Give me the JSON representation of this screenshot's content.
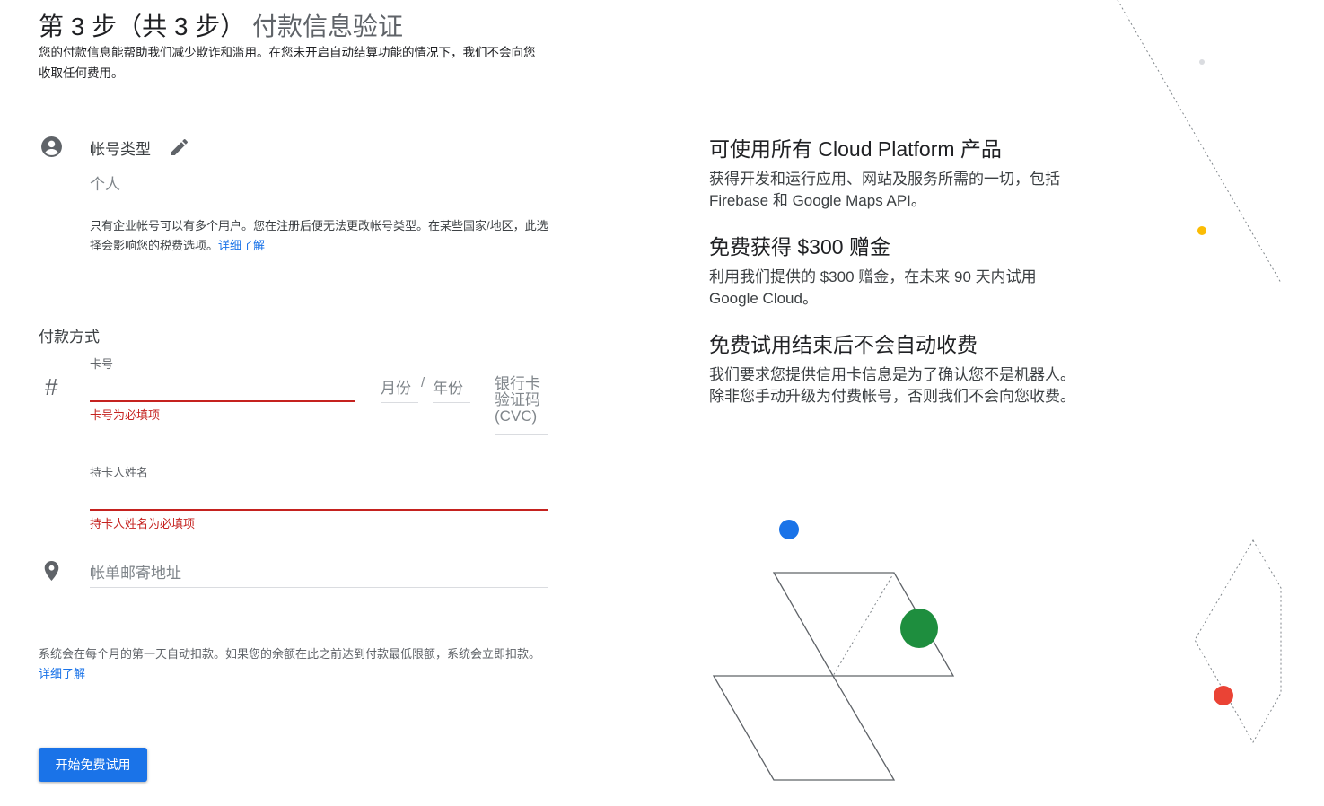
{
  "header": {
    "step_prefix": "第 3 步（共 3 步）",
    "step_title": "付款信息验证",
    "subtitle": "您的付款信息能帮助我们减少欺诈和滥用。在您未开启自动结算功能的情况下，我们不会向您收取任何费用。"
  },
  "account": {
    "label": "帐号类型",
    "value": "个人",
    "note": "只有企业帐号可以有多个用户。您在注册后便无法更改帐号类型。在某些国家/地区，此选择会影响您的税费选项。",
    "learn_more": "详细了解",
    "icons": {
      "type": "account-circle-icon",
      "edit": "pencil-icon"
    }
  },
  "payment": {
    "section_label": "付款方式",
    "card_icon": "#",
    "card_number_label": "卡号",
    "card_number_error": "卡号为必填项",
    "month_placeholder": "月份",
    "year_separator": "/",
    "year_placeholder": "年份",
    "cvc_placeholder_line1": "银行卡",
    "cvc_placeholder_line2": "验证码",
    "cvc_placeholder_line3": "(CVC)",
    "cardholder_label": "持卡人姓名",
    "cardholder_error": "持卡人姓名为必填项",
    "address_placeholder": "帐单邮寄地址",
    "error_color": "#c5221f"
  },
  "billing_note": {
    "text": "系统会在每个月的第一天自动扣款。如果您的余额在此之前达到付款最低限额，系统会立即扣款。",
    "learn_more": "详细了解"
  },
  "cta": {
    "label": "开始免费试用",
    "color": "#1a73e8"
  },
  "benefits": [
    {
      "title": "可使用所有 Cloud Platform 产品",
      "body": "获得开发和运行应用、网站及服务所需的一切，包括 Firebase 和 Google Maps API。"
    },
    {
      "title": "免费获得 $300 赠金",
      "body": "利用我们提供的 $300 赠金，在未来 90 天内试用 Google Cloud。"
    },
    {
      "title": "免费试用结束后不会自动收费",
      "body": "我们要求您提供信用卡信息是为了确认您不是机器人。除非您手动升级为付费帐号，否则我们不会向您收费。"
    }
  ],
  "decor_colors": {
    "blue": "#1a73e8",
    "green": "#1e8e3e",
    "red": "#ea4335",
    "yellow": "#fbbc04"
  }
}
